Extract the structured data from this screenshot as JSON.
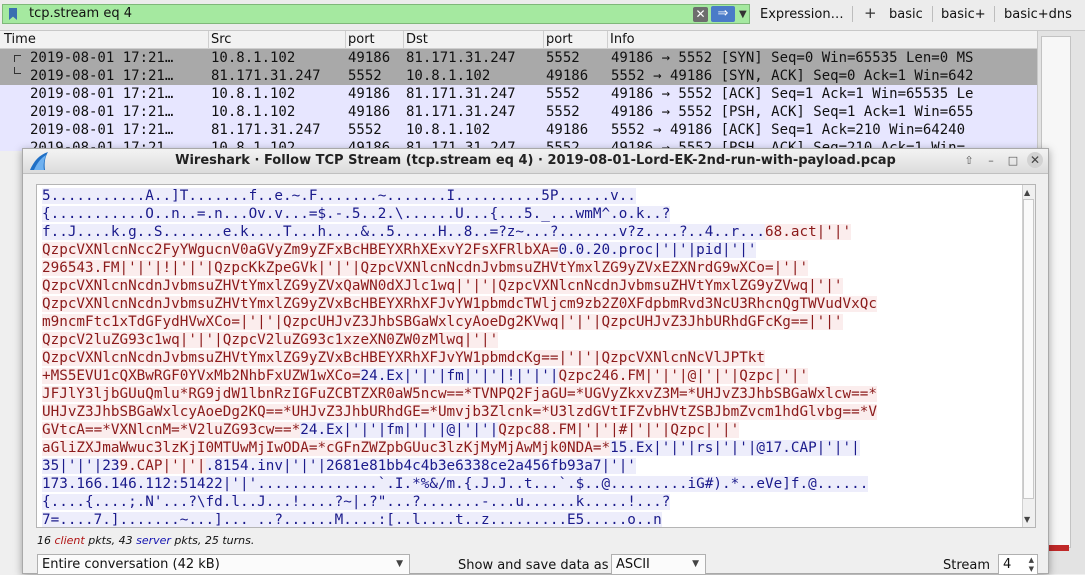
{
  "filter_bar": {
    "value": "tcp.stream eq 4",
    "expression_label": "Expression…",
    "buttons": [
      "basic",
      "basic+",
      "basic+dns"
    ]
  },
  "packet_list": {
    "columns": [
      "Time",
      "Src",
      "port",
      "Dst",
      "port",
      "Info"
    ],
    "rows": [
      {
        "time": "2019-08-01 17:21…",
        "src": "10.8.1.102",
        "sport": "49186",
        "dst": "81.171.31.247",
        "dport": "5552",
        "info": "49186 → 5552 [SYN] Seq=0 Win=65535 Len=0 MS",
        "style": "selected"
      },
      {
        "time": "2019-08-01 17:21…",
        "src": "81.171.31.247",
        "sport": "5552",
        "dst": "10.8.1.102",
        "dport": "49186",
        "info": "5552 → 49186 [SYN, ACK] Seq=0 Ack=1 Win=642",
        "style": "selected"
      },
      {
        "time": "2019-08-01 17:21…",
        "src": "10.8.1.102",
        "sport": "49186",
        "dst": "81.171.31.247",
        "dport": "5552",
        "info": "49186 → 5552 [ACK] Seq=1 Ack=1 Win=65535 Le",
        "style": "normal"
      },
      {
        "time": "2019-08-01 17:21…",
        "src": "10.8.1.102",
        "sport": "49186",
        "dst": "81.171.31.247",
        "dport": "5552",
        "info": "49186 → 5552 [PSH, ACK] Seq=1 Ack=1 Win=655",
        "style": "normal"
      },
      {
        "time": "2019-08-01 17:21…",
        "src": "81.171.31.247",
        "sport": "5552",
        "dst": "10.8.1.102",
        "dport": "49186",
        "info": "5552 → 49186 [ACK] Seq=1 Ack=210 Win=64240",
        "style": "normal"
      },
      {
        "time": "2019-08-01 17:21…",
        "src": "10.8.1.102",
        "sport": "49186",
        "dst": "81.171.31.247",
        "dport": "5552",
        "info": "49186 → 5552 [PSH, ACK] Seq=210 Ack=1 Win=",
        "style": "normal"
      }
    ]
  },
  "dialog": {
    "title": "Wireshark · Follow TCP Stream (tcp.stream eq 4) · 2019-08-01-Lord-EK-2nd-run-with-payload.pcap",
    "stream_lines": [
      [
        {
          "t": "5...........A..]T.......f..e.~.F.......~.......I..........5P......v..",
          "s": "server"
        }
      ],
      [
        {
          "t": "{...........O..n..=.n...Ov.v...=$.-.5..2.\\......U...{...5._...wmM^.o.k..?",
          "s": "server"
        }
      ],
      [
        {
          "t": "f..J....k.g..S.......e.k....T...h....&..5.....H..8..=?z~...?.......v?z....?..4..r...",
          "s": "server"
        },
        {
          "t": "68.act|'|'",
          "s": "client"
        }
      ],
      [
        {
          "t": "QzpcVXNlcnNcc2FyYWgucnV0aGVyZm9yZFxBcHBEYXRhXExvY2FsXFRlbXA=",
          "s": "client"
        },
        {
          "t": "0.0.20.proc|'|'|pid|'|'",
          "s": "server"
        }
      ],
      [
        {
          "t": "296543.FM|'|'|!|'|'|QzpcKkZpeGVk|'|'|QzpcVXNlcnNcdnJvbmsuZHVtYmxlZG9yZVxEZXNrdG9wXCo=|'|'",
          "s": "client"
        }
      ],
      [
        {
          "t": "QzpcVXNlcnNcdnJvbmsuZHVtYmxlZG9yZVxQaWN0dXJlc1wq|'|'|QzpcVXNlcnNcdnJvbmsuZHVtYmxlZG9yZVwq|'|'",
          "s": "client"
        }
      ],
      [
        {
          "t": "QzpcVXNlcnNcdnJvbmsuZHVtYmxlZG9yZVxBcHBEYXRhXFJvYW1pbmdcTWljcm9zb2Z0XFdpbmRvd3NcU3RhcnQgTWVudVxQc",
          "s": "client"
        }
      ],
      [
        {
          "t": "m9ncmFtc1xTdGFydHVwXCo=|'|'|QzpcUHJvZ3JhbSBGaWxlcyAoeDg2KVwq|'|'|QzpcUHJvZ3JhbURhdGFcKg==|'|'",
          "s": "client"
        }
      ],
      [
        {
          "t": "QzpcV2luZG93c1wq|'|'|QzpcV2luZG93c1xzeXN0ZW0zMlwq|'|'",
          "s": "client"
        }
      ],
      [
        {
          "t": "QzpcVXNlcnNcdnJvbmsuZHVtYmxlZG9yZVxBcHBEYXRhXFJvYW1pbmdcKg==|'|'|QzpcVXNlcnNcVlJPTkt",
          "s": "client"
        }
      ],
      [
        {
          "t": "+MS5EVU1cQXBwRGF0YVxMb2NhbFxUZW1wXCo=",
          "s": "client"
        },
        {
          "t": "24.Ex|'|'|fm|'|'|!|'|'|",
          "s": "server"
        },
        {
          "t": "Qzpc246.FM|'|'|@|'|'|Qzpc|'|'",
          "s": "client"
        }
      ],
      [
        {
          "t": "JFJlY3ljbGUuQmlu*RG9jdW1lbnRzIGFuZCBTZXR0aW5ncw==*TVNPQ2FjaGU=*UGVyZkxvZ3M=*UHJvZ3JhbSBGaWxlcw==*",
          "s": "client"
        }
      ],
      [
        {
          "t": "UHJvZ3JhbSBGaWxlcyAoeDg2KQ==*UHJvZ3JhbURhdGE=*Umvjb3Zlcnk=*U3lzdGVtIFZvbHVtZSBJbmZvcm1hdGlvbg==*V",
          "s": "client"
        }
      ],
      [
        {
          "t": "GVtcA==*VXNlcnM=*V2luZG93cw==*",
          "s": "client"
        },
        {
          "t": "24.Ex|'|'|fm|'|'|@|'|'|",
          "s": "server"
        },
        {
          "t": "Qzpc88.FM|'|'|#|'|'|Qzpc|'|'",
          "s": "client"
        }
      ],
      [
        {
          "t": "aGliZXJmaWwuc3lzKjI0MTUwMjIwODA=*cGFnZWZpbGUuc3lzKjMyMjAwMjk0NDA=*",
          "s": "client"
        },
        {
          "t": "15.Ex|'|'|rs|'|'|@17.CAP|'|'|",
          "s": "server"
        }
      ],
      [
        {
          "t": "35|'|'|23",
          "s": "server"
        },
        {
          "t": "9.CAP|'|'|",
          "s": "client"
        },
        {
          "t": ".8154.inv|'|'|2681e81bb4c4b3e6338ce2a456fb93a7|'|'",
          "s": "server"
        }
      ],
      [
        {
          "t": "173.166.146.112:51422|'|'",
          "s": "server"
        },
        {
          "t": "..............`.I.*%&/m.{.J.J..t...`.$..@.........iG#).*..eVe]f.@......",
          "s": "server"
        }
      ],
      [
        {
          "t": "{....{....;.N'...?\\fd.l..J...!....?~|.?\"...?.......-...u......k.....!...?",
          "s": "server"
        }
      ],
      [
        {
          "t": "7=....7.].......~...]..._..?......M....:[..l....t..z.........E5.....o..n",
          "s": "server"
        }
      ]
    ],
    "stats": {
      "client_count": "16",
      "client_word": "client",
      "server_count": "43",
      "server_word": "server",
      "prefix": " pkts, ",
      "suffix": " pkts, 25 turns."
    },
    "conversation_select": "Entire conversation (42 kB)",
    "save_label": "Show and save data as",
    "format_select": "ASCII",
    "stream_label": "Stream",
    "stream_value": "4"
  },
  "colors": {
    "filter_bg": "#a5e9a0",
    "row_selected": "#a9a9a9",
    "row_normal": "#e7e6ff",
    "client_text": "#8b1a1a",
    "server_text": "#1a1a8b"
  }
}
